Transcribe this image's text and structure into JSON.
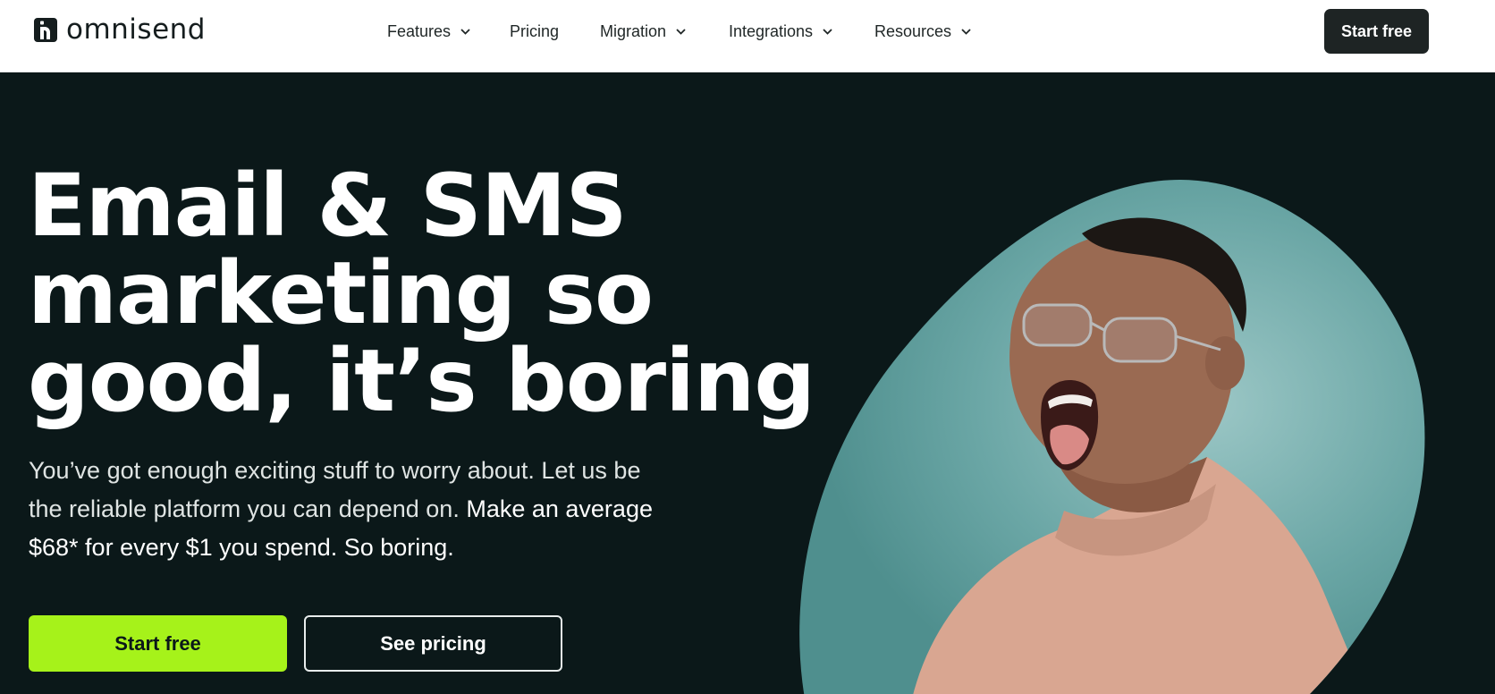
{
  "brand": {
    "name": "omnisend",
    "logo_icon": "omnisend-logo-icon"
  },
  "nav": {
    "items": [
      {
        "label": "Features",
        "has_dropdown": true
      },
      {
        "label": "Pricing",
        "has_dropdown": false
      },
      {
        "label": "Migration",
        "has_dropdown": true
      },
      {
        "label": "Integrations",
        "has_dropdown": true
      },
      {
        "label": "Resources",
        "has_dropdown": true
      }
    ],
    "cta_label": "Start free"
  },
  "hero": {
    "headline_lines": [
      "Email & SMS",
      "marketing so",
      "good, it’s boring"
    ],
    "sub_regular": "You’ve got enough exciting stuff to worry about. Let us be the reliable platform you can depend on.",
    "sub_strong": "Make an average $68* for every $1 you spend. So boring.",
    "primary_button": "Start free",
    "secondary_button": "See pricing",
    "image_description_icon": "yawning-man-photo"
  },
  "colors": {
    "hero_bg": "#0b1819",
    "accent": "#a6f21a",
    "header_button": "#1e2424",
    "image_circle": "#6aa6a5"
  }
}
